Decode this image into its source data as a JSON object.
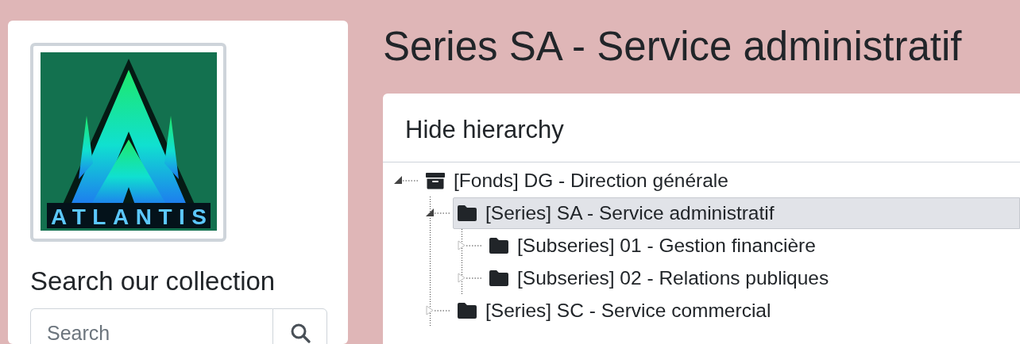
{
  "logo": {
    "text": "ATLANTIS"
  },
  "sidebar": {
    "heading": "Search our collection",
    "search": {
      "placeholder": "Search"
    }
  },
  "page_title": "Series SA - Service administratif",
  "hierarchy": {
    "toggle_label": "Hide hierarchy",
    "tree": [
      {
        "kind": "fonds",
        "label": "[Fonds] DG - Direction générale",
        "expanded": true,
        "selected": false,
        "children": [
          {
            "kind": "series",
            "label": "[Series] SA - Service administratif",
            "expanded": true,
            "selected": true,
            "children": [
              {
                "kind": "subseries",
                "label": "[Subseries] 01 - Gestion financière",
                "expanded": false,
                "selected": false
              },
              {
                "kind": "subseries",
                "label": "[Subseries] 02 - Relations publiques",
                "expanded": false,
                "selected": false
              }
            ]
          },
          {
            "kind": "series",
            "label": "[Series] SC - Service commercial",
            "expanded": false,
            "selected": false
          }
        ]
      }
    ]
  }
}
